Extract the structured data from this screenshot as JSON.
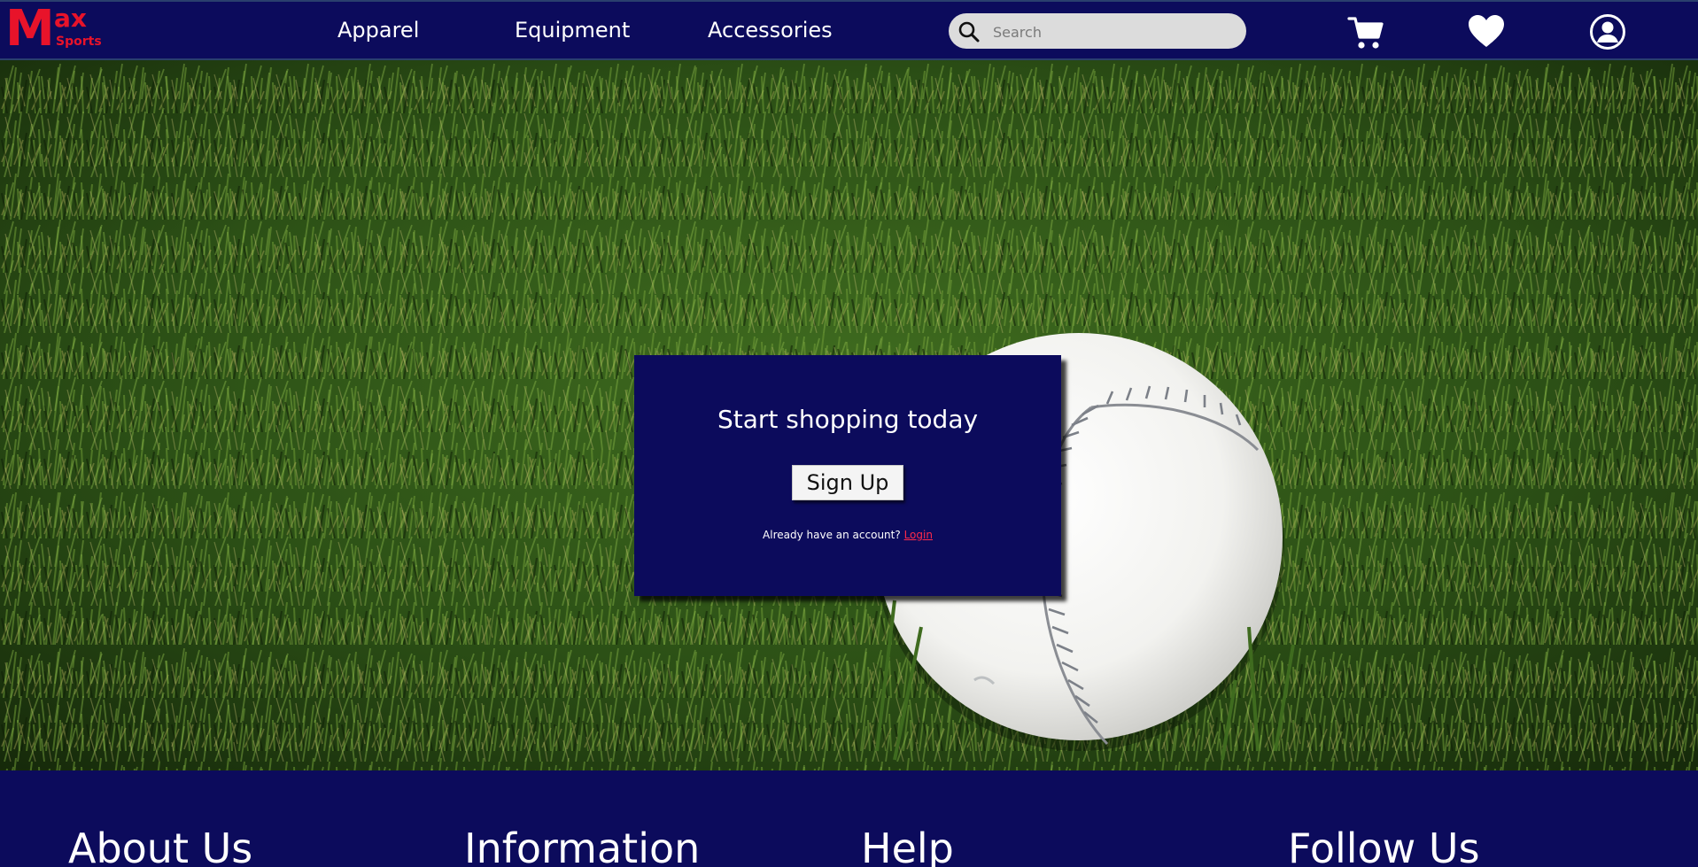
{
  "brand": {
    "logo_m": "M",
    "logo_ax": "ax",
    "logo_sports": "Sports",
    "color": "#e8132a"
  },
  "nav": {
    "items": [
      {
        "label": "Apparel"
      },
      {
        "label": "Equipment"
      },
      {
        "label": "Accessories"
      }
    ]
  },
  "search": {
    "placeholder": "Search",
    "value": "",
    "icon": "search-icon"
  },
  "header_icons": [
    {
      "name": "cart-icon"
    },
    {
      "name": "heart-icon"
    },
    {
      "name": "user-account-icon"
    }
  ],
  "hero": {
    "image": "grass-and-softball-photo",
    "card": {
      "headline": "Start shopping today",
      "signup_label": "Sign Up",
      "account_prompt": "Already have an account?",
      "login_label": "Login"
    }
  },
  "footer": {
    "columns": [
      {
        "title": "About Us"
      },
      {
        "title": "Information"
      },
      {
        "title": "Help"
      },
      {
        "title": "Follow Us"
      }
    ]
  },
  "colors": {
    "navy": "#0c0b5c",
    "accent_red": "#e8132a",
    "link_red": "#ff2a4a",
    "search_bg": "#dcdcdc"
  }
}
